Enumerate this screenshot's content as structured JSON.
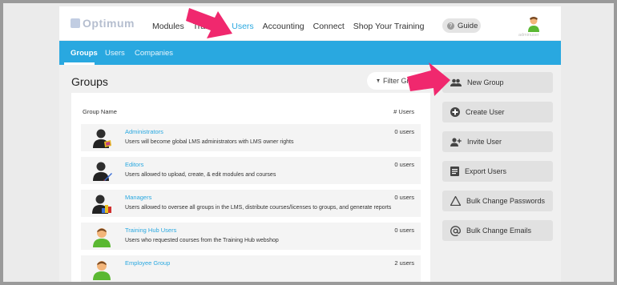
{
  "brand": {
    "logo_text": "Optimum"
  },
  "topnav": {
    "items": [
      "Modules",
      "Training",
      "Users",
      "Accounting",
      "Connect",
      "Shop Your Training"
    ],
    "active": "Users"
  },
  "guide": {
    "label": "Guide",
    "icon": "question-icon"
  },
  "user": {
    "caption": "adminuser"
  },
  "subnav": {
    "tabs": [
      "Groups",
      "Users",
      "Companies"
    ],
    "active": "Groups"
  },
  "main": {
    "title": "Groups",
    "filter_label": "Filter Groups",
    "table": {
      "headers": {
        "name": "Group Name",
        "count": "# Users"
      },
      "rows": [
        {
          "name": "Administrators",
          "description": "Users will become global LMS administrators with LMS owner rights",
          "count": "0 users",
          "icon": "admin-user-icon"
        },
        {
          "name": "Editors",
          "description": "Users allowed to upload, create, & edit modules and courses",
          "count": "0 users",
          "icon": "editor-user-icon"
        },
        {
          "name": "Managers",
          "description": "Users allowed to oversee all groups in the LMS, distribute courses/licenses to groups, and generate reports",
          "count": "0 users",
          "icon": "manager-user-icon"
        },
        {
          "name": "Training Hub Users",
          "description": "Users who requested courses from the Training Hub webshop",
          "count": "0 users",
          "icon": "user-icon"
        },
        {
          "name": "Employee Group",
          "description": "",
          "count": "2 users",
          "icon": "user-icon"
        }
      ]
    }
  },
  "actions": [
    {
      "label": "New Group",
      "icon": "group-icon"
    },
    {
      "label": "Create User",
      "icon": "plus-circle-icon"
    },
    {
      "label": "Invite User",
      "icon": "add-person-icon"
    },
    {
      "label": "Export Users",
      "icon": "document-icon"
    },
    {
      "label": "Bulk Change Passwords",
      "icon": "warning-icon"
    },
    {
      "label": "Bulk Change Emails",
      "icon": "at-icon"
    }
  ],
  "colors": {
    "accent": "#29a8e0",
    "highlight_arrow": "#f0286e",
    "button_bg": "#e1e1e1"
  }
}
